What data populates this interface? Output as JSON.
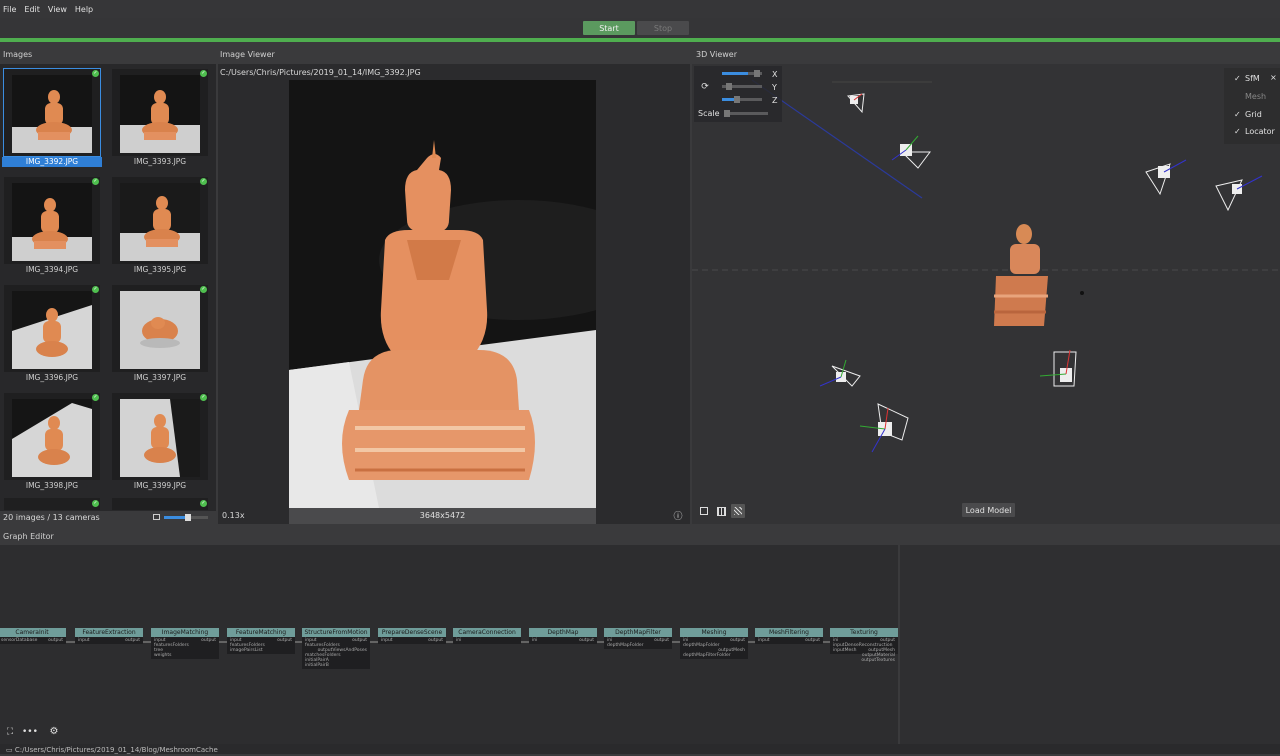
{
  "menu": [
    "File",
    "Edit",
    "View",
    "Help"
  ],
  "toolbar": {
    "start_label": "Start",
    "stop_label": "Stop"
  },
  "images": {
    "title": "Images",
    "items": [
      {
        "label": "IMG_3392.JPG",
        "selected": true
      },
      {
        "label": "IMG_3393.JPG"
      },
      {
        "label": "IMG_3394.JPG"
      },
      {
        "label": "IMG_3395.JPG"
      },
      {
        "label": "IMG_3396.JPG"
      },
      {
        "label": "IMG_3397.JPG"
      },
      {
        "label": "IMG_3398.JPG"
      },
      {
        "label": "IMG_3399.JPG"
      }
    ],
    "count_text": "20 images / 13 cameras"
  },
  "viewer": {
    "title": "Image Viewer",
    "path": "C:/Users/Chris/Pictures/2019_01_14/IMG_3392.JPG",
    "zoom": "0.13x",
    "resolution": "3648x5472"
  },
  "viewer3d": {
    "title": "3D Viewer",
    "axes": [
      "X",
      "Y",
      "Z"
    ],
    "scale_label": "Scale",
    "toggles": [
      {
        "label": "SfM",
        "checked": true
      },
      {
        "label": "Mesh",
        "checked": false
      },
      {
        "label": "Grid",
        "checked": true
      },
      {
        "label": "Locator",
        "checked": true
      }
    ],
    "close": "×",
    "load_model": "Load Model"
  },
  "graph": {
    "title": "Graph Editor",
    "nodes": [
      {
        "label": "CameraInit",
        "inputs": [
          "sensorDatabase"
        ],
        "outputs": [
          "output"
        ]
      },
      {
        "label": "FeatureExtraction",
        "inputs": [
          "input"
        ],
        "outputs": [
          "output"
        ]
      },
      {
        "label": "ImageMatching",
        "inputs": [
          "input",
          "featuresFolders",
          "tree",
          "weights"
        ],
        "outputs": [
          "output"
        ]
      },
      {
        "label": "FeatureMatching",
        "inputs": [
          "input",
          "featuresFolders",
          "imagePairsList"
        ],
        "outputs": [
          "output"
        ]
      },
      {
        "label": "StructureFromMotion",
        "inputs": [
          "input",
          "featuresFolders",
          "matchesFolders",
          "initialPairA",
          "initialPairB"
        ],
        "outputs": [
          "output",
          "outputViewsAndPoses",
          "extraInfoFolder"
        ]
      },
      {
        "label": "PrepareDenseScene",
        "inputs": [
          "input"
        ],
        "outputs": [
          "output"
        ]
      },
      {
        "label": "CameraConnection",
        "inputs": [
          "ini"
        ],
        "outputs": []
      },
      {
        "label": "DepthMap",
        "inputs": [
          "ini"
        ],
        "outputs": [
          "output"
        ]
      },
      {
        "label": "DepthMapFilter",
        "inputs": [
          "ini",
          "depthMapFolder"
        ],
        "outputs": [
          "output"
        ]
      },
      {
        "label": "Meshing",
        "inputs": [
          "ini",
          "depthMapFolder",
          "depthMapFilterFolder"
        ],
        "outputs": [
          "output",
          "outputMesh"
        ]
      },
      {
        "label": "MeshFiltering",
        "inputs": [
          "input"
        ],
        "outputs": [
          "output"
        ]
      },
      {
        "label": "Texturing",
        "inputs": [
          "ini",
          "inputDenseReconstruction",
          "inputMesh"
        ],
        "outputs": [
          "output",
          "outputMesh",
          "outputMaterial",
          "outputTextures"
        ]
      }
    ]
  },
  "status": "C:/Users/Chris/Pictures/2019_01_14/Blog/MeshroomCache",
  "colors": {
    "accent": "#4fae4f",
    "selection": "#2f7fd6",
    "node_header": "#6f9d9a",
    "statue": "#e2915a"
  }
}
